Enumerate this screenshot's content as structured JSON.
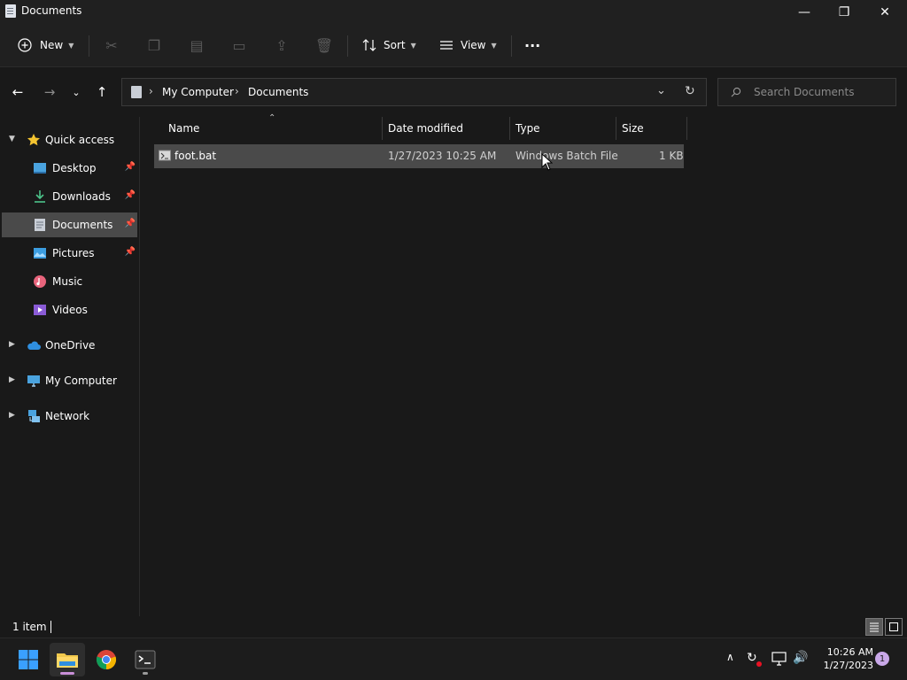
{
  "window": {
    "title": "Documents",
    "minimize_glyph": "—",
    "restore_glyph": "❐",
    "close_glyph": "✕"
  },
  "toolbar": {
    "new_label": "New",
    "sort_label": "Sort",
    "view_label": "View",
    "more_glyph": "···"
  },
  "address": {
    "crumbs": [
      "My Computer",
      "Documents"
    ],
    "separator": "›",
    "search_placeholder": "Search Documents"
  },
  "navigation": {
    "quick_access": "Quick access",
    "items": [
      {
        "label": "Desktop",
        "icon": "desktop-icon",
        "pinned": true
      },
      {
        "label": "Downloads",
        "icon": "downloads-icon",
        "pinned": true
      },
      {
        "label": "Documents",
        "icon": "documents-icon",
        "pinned": true,
        "selected": true
      },
      {
        "label": "Pictures",
        "icon": "pictures-icon",
        "pinned": true
      },
      {
        "label": "Music",
        "icon": "music-icon"
      },
      {
        "label": "Videos",
        "icon": "videos-icon"
      }
    ],
    "onedrive": "OneDrive",
    "my_computer": "My Computer",
    "network": "Network"
  },
  "columns": {
    "name": "Name",
    "date": "Date modified",
    "type": "Type",
    "size": "Size"
  },
  "files": [
    {
      "name": "foot.bat",
      "date": "1/27/2023 10:25 AM",
      "type": "Windows Batch File",
      "size": "1 KB",
      "selected": true
    }
  ],
  "status": {
    "count": "1 item"
  },
  "taskbar": {
    "time": "10:26 AM",
    "date": "1/27/2023",
    "notifications": "1"
  },
  "colors": {
    "background": "#191919",
    "selection": "#4a4a4a",
    "accent": "#0078d4"
  }
}
